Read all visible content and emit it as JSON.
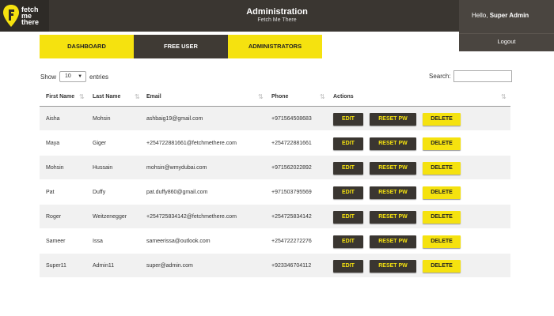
{
  "logo": {
    "line1": "fetch",
    "line2": "me",
    "line3": "there"
  },
  "header": {
    "title": "Administration",
    "subtitle": "Fetch Me There"
  },
  "user": {
    "greeting": "Hello,",
    "name": "Super Admin",
    "logout": "Logout"
  },
  "tabs": [
    {
      "label": "DASHBOARD",
      "active": false
    },
    {
      "label": "FREE USER",
      "active": true
    },
    {
      "label": "ADMINISTRATORS",
      "active": false
    }
  ],
  "controls": {
    "show_label": "Show",
    "entries_value": "10",
    "entries_label": "entries",
    "search_label": "Search:",
    "search_value": ""
  },
  "table": {
    "headers": [
      "First Name",
      "Last Name",
      "Email",
      "Phone",
      "Actions"
    ],
    "rows": [
      {
        "first": "Aisha",
        "last": "Mohsin",
        "email": "ashbaig19@gmail.com",
        "phone": "+971564508683"
      },
      {
        "first": "Maya",
        "last": "Giger",
        "email": "+254722881661@fetchmethere.com",
        "phone": "+254722881661"
      },
      {
        "first": "Mohsin",
        "last": "Hussain",
        "email": "mohsin@wmydubai.com",
        "phone": "+971562022892"
      },
      {
        "first": "Pat",
        "last": "Duffy",
        "email": "pat.duffy860@gmail.com",
        "phone": "+971503795569"
      },
      {
        "first": "Roger",
        "last": "Weitzenegger",
        "email": "+254725834142@fetchmethere.com",
        "phone": "+254725834142"
      },
      {
        "first": "Sameer",
        "last": "Issa",
        "email": "sameerissa@outlook.com",
        "phone": "+254722272276"
      },
      {
        "first": "Super11",
        "last": "Admin11",
        "email": "super@admin.com",
        "phone": "+923346704112"
      }
    ],
    "actions": {
      "edit": "EDIT",
      "reset": "RESET PW",
      "delete": "DELETE"
    }
  },
  "colors": {
    "accent": "#f5e20f",
    "dark": "#3a3631"
  }
}
